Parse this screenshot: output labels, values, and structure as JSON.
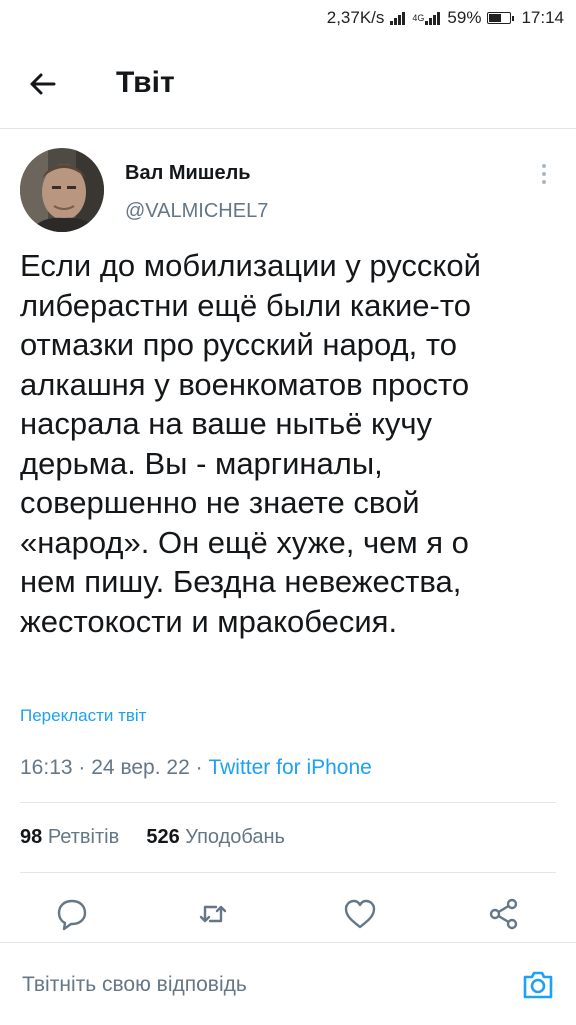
{
  "status_bar": {
    "speed": "2,37K/s",
    "network": "4G",
    "battery_text": "59%",
    "battery_level": 0.59,
    "time": "17:14"
  },
  "header": {
    "title": "Твіт"
  },
  "author": {
    "name": "Вал Мишель",
    "handle": "@VALMICHEL7"
  },
  "tweet": {
    "text": "Если до мобилизации у русской\nлиберастни ещё были какие-то\nотмазки про русский народ, то\nалкашня у военкоматов просто\nнасрала на ваше нытьё кучу\nдерьма. Вы - маргиналы,\nсовершенно не знаете свой\n«народ». Он ещё хуже, чем я о\nнем пишу. Бездна невежества,\nжестокости и мракобесия.",
    "translate_label": "Перекласти твіт",
    "time": "16:13",
    "date": "24 вер. 22",
    "separator": "·",
    "source": "Twitter for iPhone"
  },
  "stats": {
    "retweets_count": "98",
    "retweets_label": "Ретвітів",
    "likes_count": "526",
    "likes_label": "Уподобань"
  },
  "actions": [
    "reply-icon",
    "retweet-icon",
    "like-icon",
    "share-icon"
  ],
  "reply": {
    "placeholder": "Твітніть свою відповідь"
  },
  "colors": {
    "accent": "#1da1f2",
    "text": "#14171a",
    "secondary": "#657786",
    "divider": "#e1e8ed"
  }
}
